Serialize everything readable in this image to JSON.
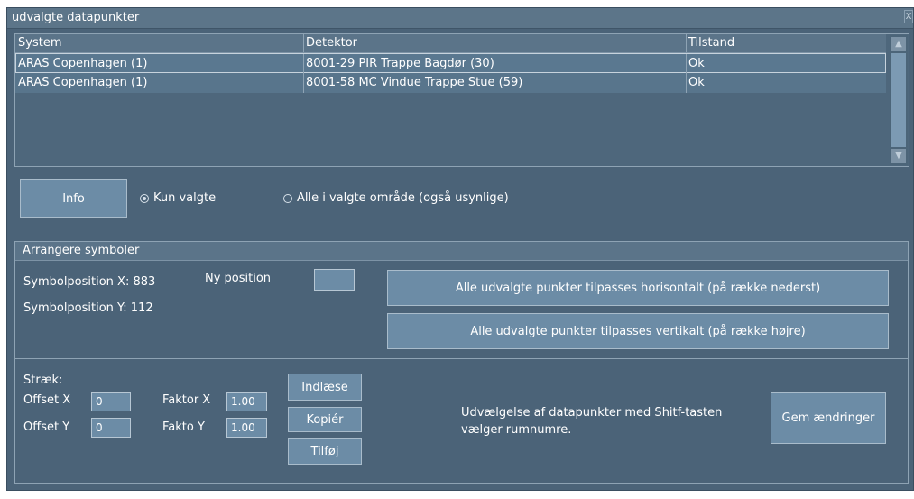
{
  "window": {
    "title": "udvalgte datapunkter",
    "close_glyph": "X"
  },
  "table": {
    "columns": [
      "System",
      "Detektor",
      "Tilstand"
    ],
    "rows": [
      {
        "system": "ARAS Copenhagen (1)",
        "detektor": "8001-29 PIR Trappe Bagdør (30)",
        "tilstand": "Ok"
      },
      {
        "system": "ARAS Copenhagen (1)",
        "detektor": "8001-58 MC Vindue Trappe Stue (59)",
        "tilstand": "Ok"
      }
    ],
    "scroll_up_icon": "triangle-up-icon",
    "scroll_down_icon": "triangle-down-icon"
  },
  "controls": {
    "info_label": "Info",
    "radio_selected_label": "Kun valgte",
    "radio_all_label": "Alle i valgte område (også usynlige)"
  },
  "arrange": {
    "header": "Arrangere symboler",
    "pos_x": "Symbolposition X: 883",
    "pos_y": "Symbolposition Y: 112",
    "new_position_label": "Ny position",
    "new_position_value": "",
    "horizontal_button": "Alle udvalgte punkter tilpasses horisontalt (på række nederst)",
    "vertical_button": "Alle udvalgte punkter tilpasses vertikalt (på række højre)"
  },
  "line": {
    "label": "Stræk:",
    "offset_x_label": "Offset X",
    "offset_x_value": "0",
    "offset_y_label": "Offset Y",
    "offset_y_value": "0",
    "factor_x_label": "Faktor X",
    "factor_x_value": "1.00",
    "factor_y_label": "Fakto Y",
    "factor_y_value": "1.00",
    "load_button": "Indlæse",
    "copy_button": "Kopiér",
    "add_button": "Tilføj",
    "hint_line1": "Udvælgelse af datapunkter med Shitf-tasten",
    "hint_line2": "vælger rumnumre.",
    "save_button": "Gem ændringer"
  }
}
